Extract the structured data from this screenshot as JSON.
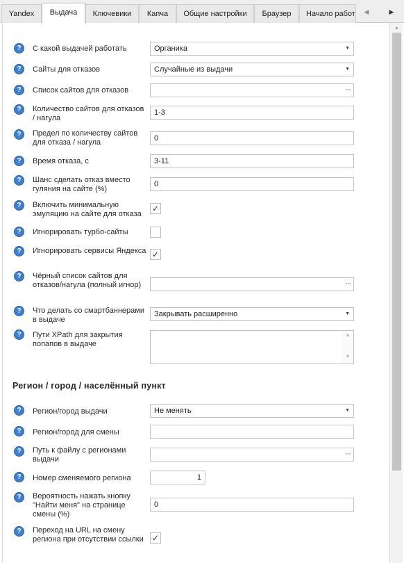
{
  "tabs": [
    {
      "label": "Yandex"
    },
    {
      "label": "Выдача"
    },
    {
      "label": "Ключевики"
    },
    {
      "label": "Капча"
    },
    {
      "label": "Общие настройки"
    },
    {
      "label": "Браузер"
    },
    {
      "label": "Начало работ"
    }
  ],
  "active_tab": "Выдача",
  "help_glyph": "?",
  "rows": {
    "results_mode": {
      "label": "С какой выдачей работать",
      "value": "Органика"
    },
    "bounce_sites": {
      "label": "Сайты для отказов",
      "value": "Случайные из выдачи"
    },
    "bounce_site_list": {
      "label": "Список сайтов для отказов",
      "value": ""
    },
    "bounce_count": {
      "label": "Количество сайтов для отказов / нагула",
      "value": "1-3"
    },
    "bounce_limit": {
      "label": "Предел по количеству сайтов для отказа / нагула",
      "value": "0"
    },
    "bounce_time": {
      "label": "Время отказа, с",
      "value": "3-11"
    },
    "bounce_chance": {
      "label": "Шанс сделать отказ вместо гуляния на сайте (%)",
      "value": "0"
    },
    "min_emulation": {
      "label": "Включить минимальную эмуляцию на сайте для отказа",
      "checked": true
    },
    "ignore_turbo": {
      "label": "Игнорировать турбо-сайты",
      "checked": false
    },
    "ignore_yandex": {
      "label": "Игнорировать сервисы Яндекса",
      "checked": true
    },
    "blacklist": {
      "label": "Чёрный список сайтов для отказов/нагула (полный игнор)",
      "value": ""
    },
    "smartbanners": {
      "label": "Что делать со смартбаннерами в выдаче",
      "value": "Закрывать расширенно"
    },
    "xpath_popups": {
      "label": "Пути XPath для закрытия попапов в выдаче",
      "value": ""
    }
  },
  "region_section": {
    "title": "Регион / город / населённый пункт",
    "rows": {
      "region_results": {
        "label": "Регион/город выдачи",
        "value": "Не менять"
      },
      "region_change": {
        "label": "Регион/город для смены",
        "value": ""
      },
      "regions_file": {
        "label": "Путь к файлу с регионами выдачи",
        "value": ""
      },
      "region_number": {
        "label": "Номер сменяемого региона",
        "value": "1"
      },
      "find_me_chance": {
        "label": "Вероятность нажать кнопку \"Найти меня\" на странице смены (%)",
        "value": "0"
      },
      "url_fallback": {
        "label": "Переход на URL на смену региона при отсутствии ссылки",
        "checked": true
      }
    }
  },
  "glyphs": {
    "check": "✓",
    "dropdown": "▼",
    "ellipsis": "···",
    "scroll_up": "▲",
    "scroll_down": "▼",
    "tab_prev": "◀",
    "tab_next": "▶"
  }
}
